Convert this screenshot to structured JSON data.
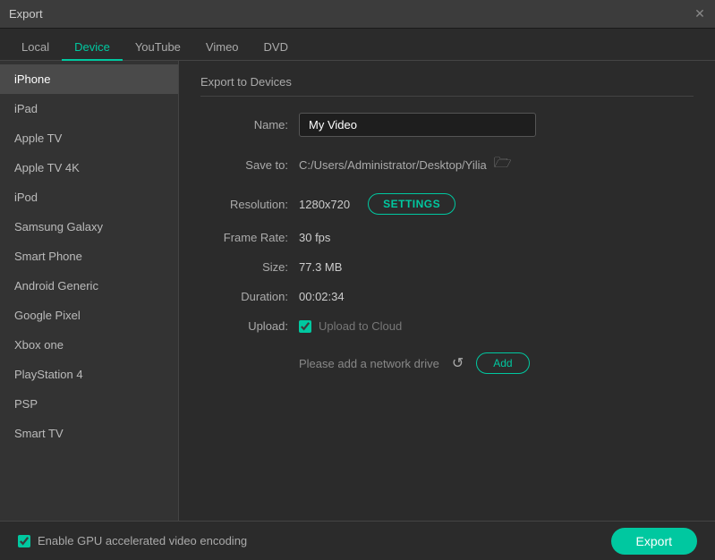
{
  "window": {
    "title": "Export",
    "close_icon": "✕"
  },
  "tabs": [
    {
      "id": "local",
      "label": "Local",
      "active": false
    },
    {
      "id": "device",
      "label": "Device",
      "active": true
    },
    {
      "id": "youtube",
      "label": "YouTube",
      "active": false
    },
    {
      "id": "vimeo",
      "label": "Vimeo",
      "active": false
    },
    {
      "id": "dvd",
      "label": "DVD",
      "active": false
    }
  ],
  "sidebar": {
    "items": [
      {
        "id": "iphone",
        "label": "iPhone",
        "active": true
      },
      {
        "id": "ipad",
        "label": "iPad",
        "active": false
      },
      {
        "id": "apple-tv",
        "label": "Apple TV",
        "active": false
      },
      {
        "id": "apple-tv-4k",
        "label": "Apple TV 4K",
        "active": false
      },
      {
        "id": "ipod",
        "label": "iPod",
        "active": false
      },
      {
        "id": "samsung-galaxy",
        "label": "Samsung Galaxy",
        "active": false
      },
      {
        "id": "smart-phone",
        "label": "Smart Phone",
        "active": false
      },
      {
        "id": "android-generic",
        "label": "Android Generic",
        "active": false
      },
      {
        "id": "google-pixel",
        "label": "Google Pixel",
        "active": false
      },
      {
        "id": "xbox-one",
        "label": "Xbox one",
        "active": false
      },
      {
        "id": "playstation-4",
        "label": "PlayStation 4",
        "active": false
      },
      {
        "id": "psp",
        "label": "PSP",
        "active": false
      },
      {
        "id": "smart-tv",
        "label": "Smart TV",
        "active": false
      }
    ]
  },
  "main": {
    "section_title": "Export to Devices",
    "name_label": "Name:",
    "name_value": "My Video",
    "save_to_label": "Save to:",
    "save_to_path": "C:/Users/Administrator/Desktop/Yilia",
    "resolution_label": "Resolution:",
    "resolution_value": "1280x720",
    "settings_btn": "SETTINGS",
    "frame_rate_label": "Frame Rate:",
    "frame_rate_value": "30 fps",
    "size_label": "Size:",
    "size_value": "77.3 MB",
    "duration_label": "Duration:",
    "duration_value": "00:02:34",
    "upload_label": "Upload:",
    "upload_cloud_label": "Upload to Cloud",
    "network_drive_text": "Please add a network drive",
    "add_btn": "Add",
    "refresh_icon": "↺"
  },
  "bottom": {
    "gpu_label": "Enable GPU accelerated video encoding",
    "export_btn": "Export"
  }
}
